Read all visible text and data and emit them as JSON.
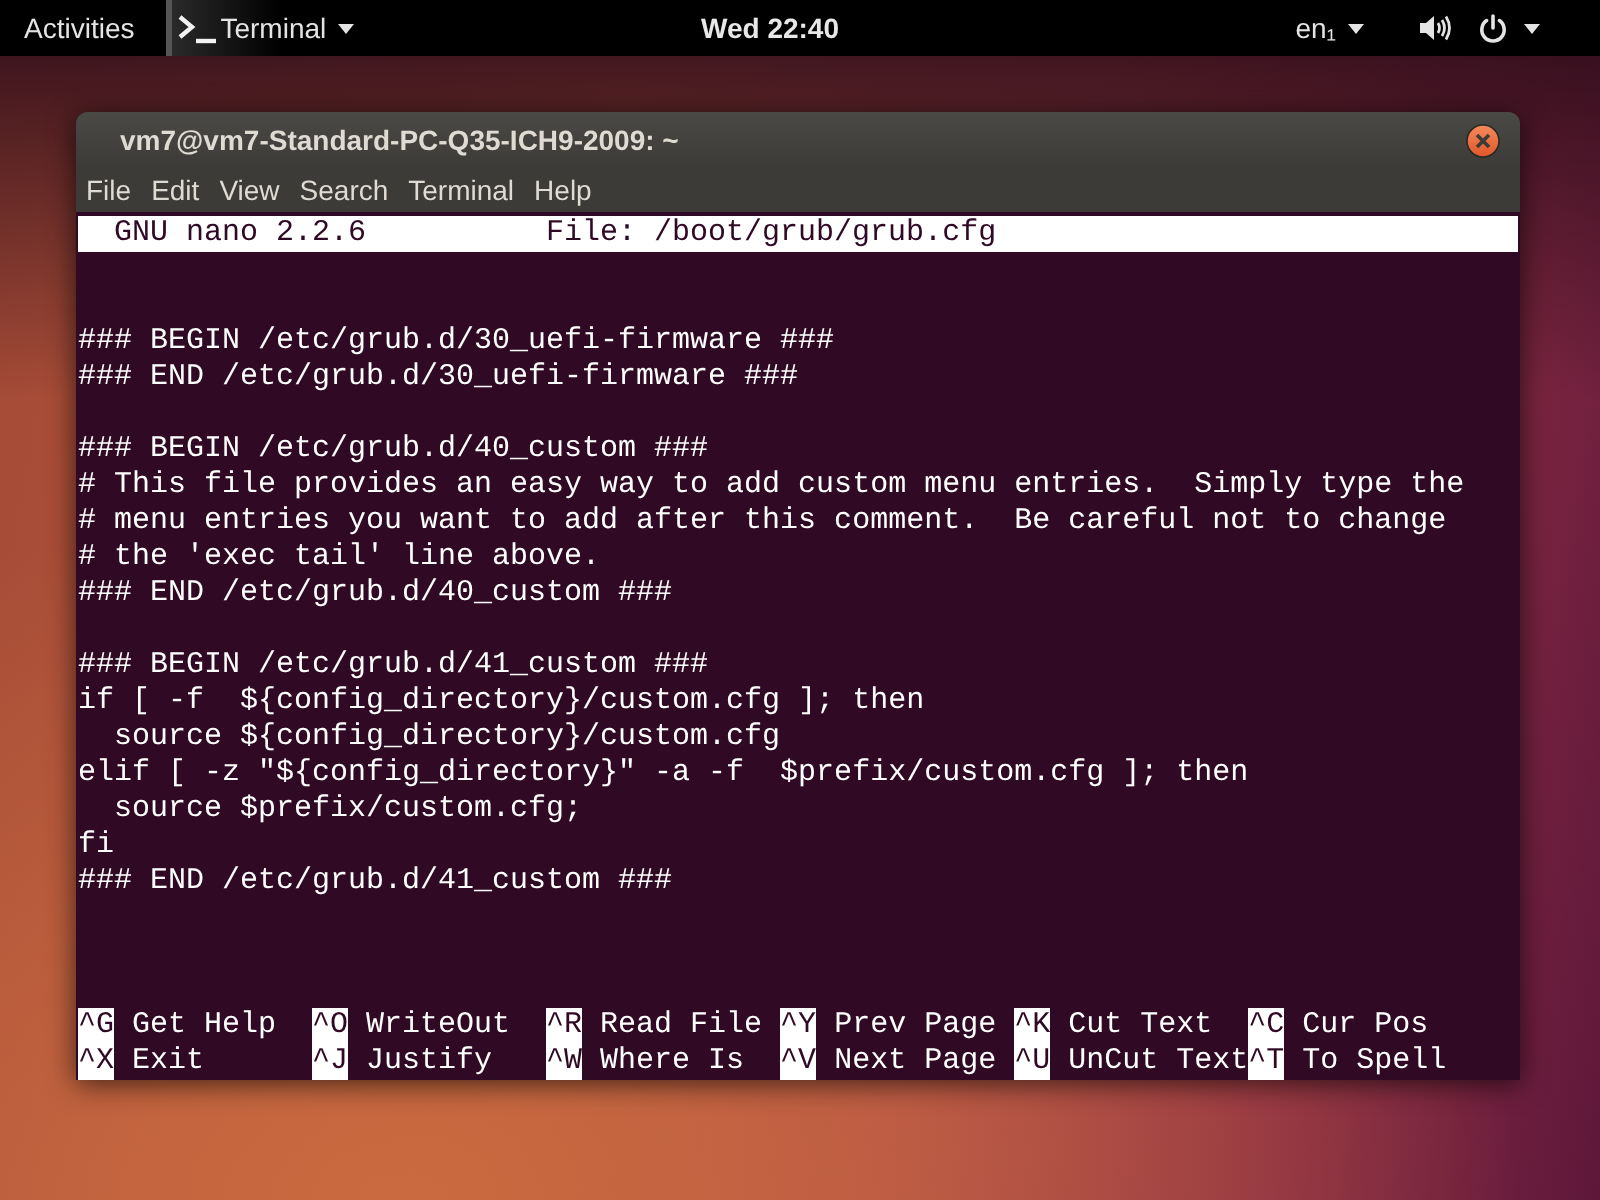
{
  "top_bar": {
    "activities": "Activities",
    "app_menu": "Terminal",
    "clock": "Wed 22:40",
    "input_source": "en₁"
  },
  "window": {
    "title": "vm7@vm7-Standard-PC-Q35-ICH9-2009: ~",
    "menu": [
      "File",
      "Edit",
      "View",
      "Search",
      "Terminal",
      "Help"
    ]
  },
  "nano": {
    "header": {
      "version": "GNU nano 2.2.6",
      "file": "File: /boot/grub/grub.cfg"
    },
    "blocks": [
      [
        "### BEGIN /etc/grub.d/30_uefi-firmware ###",
        "### END /etc/grub.d/30_uefi-firmware ###"
      ],
      [
        "### BEGIN /etc/grub.d/40_custom ###",
        "# This file provides an easy way to add custom menu entries.  Simply type the",
        "# menu entries you want to add after this comment.  Be careful not to change",
        "# the 'exec tail' line above.",
        "### END /etc/grub.d/40_custom ###"
      ],
      [
        "### BEGIN /etc/grub.d/41_custom ###",
        "if [ -f  ${config_directory}/custom.cfg ]; then",
        "  source ${config_directory}/custom.cfg",
        "elif [ -z \"${config_directory}\" -a -f  $prefix/custom.cfg ]; then",
        "  source $prefix/custom.cfg;",
        "fi",
        "### END /etc/grub.d/41_custom ###"
      ]
    ],
    "shortcut_rows": [
      [
        {
          "key": "^G",
          "label": "Get Help"
        },
        {
          "key": "^O",
          "label": "WriteOut"
        },
        {
          "key": "^R",
          "label": "Read File"
        },
        {
          "key": "^Y",
          "label": "Prev Page"
        },
        {
          "key": "^K",
          "label": "Cut Text"
        },
        {
          "key": "^C",
          "label": "Cur Pos"
        }
      ],
      [
        {
          "key": "^X",
          "label": "Exit"
        },
        {
          "key": "^J",
          "label": "Justify"
        },
        {
          "key": "^W",
          "label": "Where Is"
        },
        {
          "key": "^V",
          "label": "Next Page"
        },
        {
          "key": "^U",
          "label": "UnCut Text"
        },
        {
          "key": "^T",
          "label": "To Spell"
        }
      ]
    ]
  }
}
